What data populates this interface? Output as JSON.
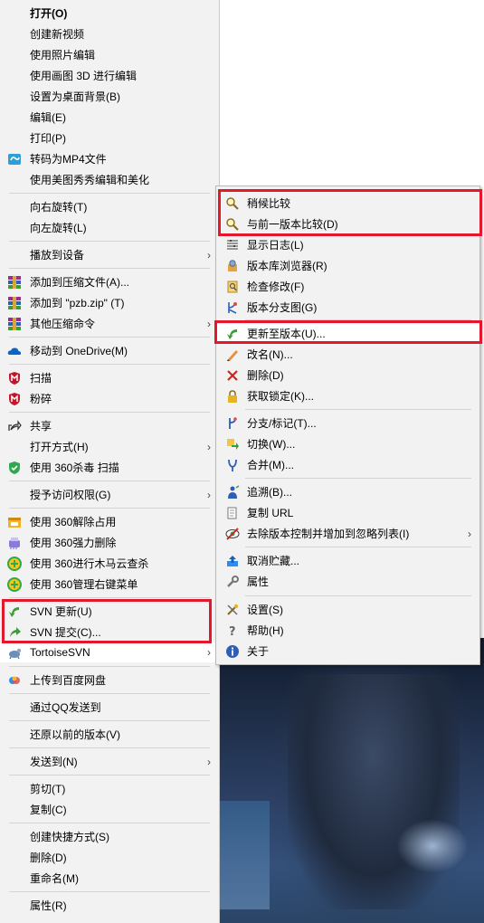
{
  "main_menu": {
    "items": [
      {
        "label": "打开(O)"
      },
      {
        "label": "创建新视频"
      },
      {
        "label": "使用照片编辑"
      },
      {
        "label": "使用画图 3D 进行编辑"
      },
      {
        "label": "设置为桌面背景(B)"
      },
      {
        "label": "编辑(E)"
      },
      {
        "label": "打印(P)"
      },
      {
        "label": "转码为MP4文件"
      },
      {
        "label": "使用美图秀秀编辑和美化"
      },
      {
        "label": "向右旋转(T)"
      },
      {
        "label": "向左旋转(L)"
      },
      {
        "label": "播放到设备"
      },
      {
        "label": "添加到压缩文件(A)..."
      },
      {
        "label": "添加到 \"pzb.zip\" (T)"
      },
      {
        "label": "其他压缩命令"
      },
      {
        "label": "移动到 OneDrive(M)"
      },
      {
        "label": "扫描"
      },
      {
        "label": "粉碎"
      },
      {
        "label": "共享"
      },
      {
        "label": "打开方式(H)"
      },
      {
        "label": "使用 360杀毒 扫描"
      },
      {
        "label": "授予访问权限(G)"
      },
      {
        "label": "使用 360解除占用"
      },
      {
        "label": "使用 360强力删除"
      },
      {
        "label": "使用 360进行木马云查杀"
      },
      {
        "label": "使用 360管理右键菜单"
      },
      {
        "label": "SVN 更新(U)"
      },
      {
        "label": "SVN 提交(C)..."
      },
      {
        "label": "TortoiseSVN"
      },
      {
        "label": "上传到百度网盘"
      },
      {
        "label": "通过QQ发送到"
      },
      {
        "label": "还原以前的版本(V)"
      },
      {
        "label": "发送到(N)"
      },
      {
        "label": "剪切(T)"
      },
      {
        "label": "复制(C)"
      },
      {
        "label": "创建快捷方式(S)"
      },
      {
        "label": "删除(D)"
      },
      {
        "label": "重命名(M)"
      },
      {
        "label": "属性(R)"
      }
    ],
    "submenu_arrow": "›"
  },
  "sub_menu": {
    "items": [
      {
        "label": "稍候比较"
      },
      {
        "label": "与前一版本比较(D)"
      },
      {
        "label": "显示日志(L)"
      },
      {
        "label": "版本库浏览器(R)"
      },
      {
        "label": "检查修改(F)"
      },
      {
        "label": "版本分支图(G)"
      },
      {
        "label": "更新至版本(U)..."
      },
      {
        "label": "改名(N)..."
      },
      {
        "label": "删除(D)"
      },
      {
        "label": "获取锁定(K)..."
      },
      {
        "label": "分支/标记(T)..."
      },
      {
        "label": "切换(W)..."
      },
      {
        "label": "合并(M)..."
      },
      {
        "label": "追溯(B)..."
      },
      {
        "label": "复制 URL"
      },
      {
        "label": "去除版本控制并增加到忽略列表(I)"
      },
      {
        "label": "取消贮藏..."
      },
      {
        "label": "属性"
      },
      {
        "label": "设置(S)"
      },
      {
        "label": "帮助(H)"
      },
      {
        "label": "关于"
      }
    ]
  },
  "colors": {
    "menu_bg": "#f2f2f2",
    "highlight_box": "#e3182d",
    "separator": "#d4d4d4"
  }
}
